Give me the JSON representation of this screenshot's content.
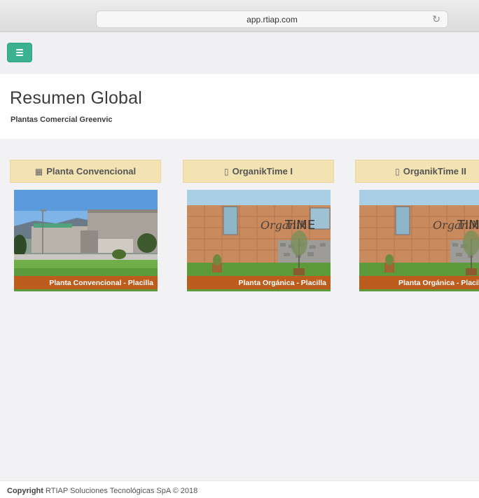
{
  "browser": {
    "url": "app.rtiap.com",
    "reload_icon": "reload-icon"
  },
  "nav": {
    "menu_icon": "hamburger-icon",
    "accent": "#3cb18f"
  },
  "header": {
    "title": "Resumen Global",
    "subtitle": "Plantas Comercial Greenvic"
  },
  "cards": [
    {
      "title": "Planta Convencional",
      "icon": "building-icon",
      "caption": "Planta Convencional - Placilla"
    },
    {
      "title": "OrganikTime I",
      "icon": "building-icon",
      "caption": "Planta Orgánica - Placilla"
    },
    {
      "title": "OrganikTime II",
      "icon": "building-icon",
      "caption": "Planta Orgánica - Placilla"
    }
  ],
  "colors": {
    "card_header": "#f3e2b2",
    "caption_bg": "#c4581c"
  },
  "footer": {
    "label": "Copyright",
    "text": "RTIAP Soluciones Tecnológicas SpA © 2018"
  }
}
